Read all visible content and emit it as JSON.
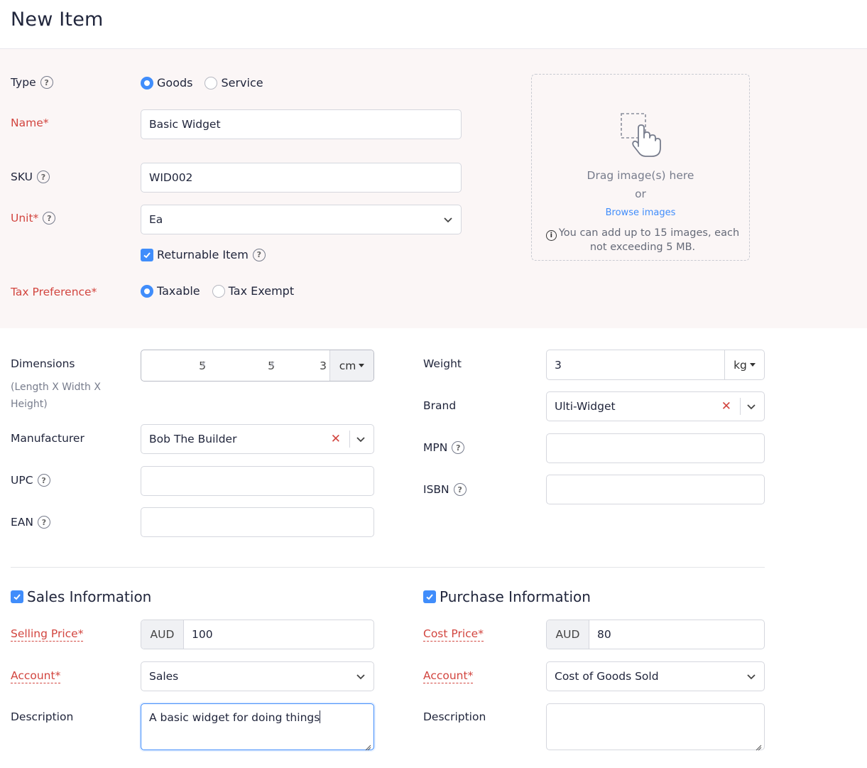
{
  "header": {
    "title": "New Item"
  },
  "form": {
    "type": {
      "label": "Type",
      "options": [
        "Goods",
        "Service"
      ],
      "selected": "Goods"
    },
    "name": {
      "label": "Name*",
      "value": "Basic Widget"
    },
    "sku": {
      "label": "SKU",
      "value": "WID002"
    },
    "unit": {
      "label": "Unit*",
      "value": "Ea"
    },
    "returnable": {
      "label": "Returnable Item",
      "checked": true
    },
    "tax": {
      "label": "Tax Preference*",
      "options": [
        "Taxable",
        "Tax Exempt"
      ],
      "selected": "Taxable"
    }
  },
  "image_upload": {
    "drag_text": "Drag image(s) here",
    "or_text": "or",
    "browse_link": "Browse images",
    "note": "You can add up to 15 images, each not exceeding 5 MB."
  },
  "dimensions": {
    "label": "Dimensions",
    "sublabel": "(Length X Width X Height)",
    "length": "5",
    "width": "5",
    "height": "3",
    "separator": "x",
    "unit": "cm"
  },
  "weight": {
    "label": "Weight",
    "value": "3",
    "unit": "kg"
  },
  "brand": {
    "label": "Brand",
    "value": "Ulti-Widget"
  },
  "manufacturer": {
    "label": "Manufacturer",
    "value": "Bob The Builder"
  },
  "mpn": {
    "label": "MPN",
    "value": ""
  },
  "upc": {
    "label": "UPC",
    "value": ""
  },
  "isbn": {
    "label": "ISBN",
    "value": ""
  },
  "ean": {
    "label": "EAN",
    "value": ""
  },
  "sales": {
    "title": "Sales Information",
    "checked": true,
    "price_label": "Selling Price*",
    "currency": "AUD",
    "price": "100",
    "account_label": "Account*",
    "account": "Sales",
    "description_label": "Description",
    "description": "A basic widget for doing things"
  },
  "purchase": {
    "title": "Purchase Information",
    "checked": true,
    "price_label": "Cost Price*",
    "currency": "AUD",
    "price": "80",
    "account_label": "Account*",
    "account": "Cost of Goods Sold",
    "description_label": "Description",
    "description": ""
  },
  "colors": {
    "accent": "#408dfb",
    "required": "#d2453f",
    "band": "#fbf6f6"
  }
}
